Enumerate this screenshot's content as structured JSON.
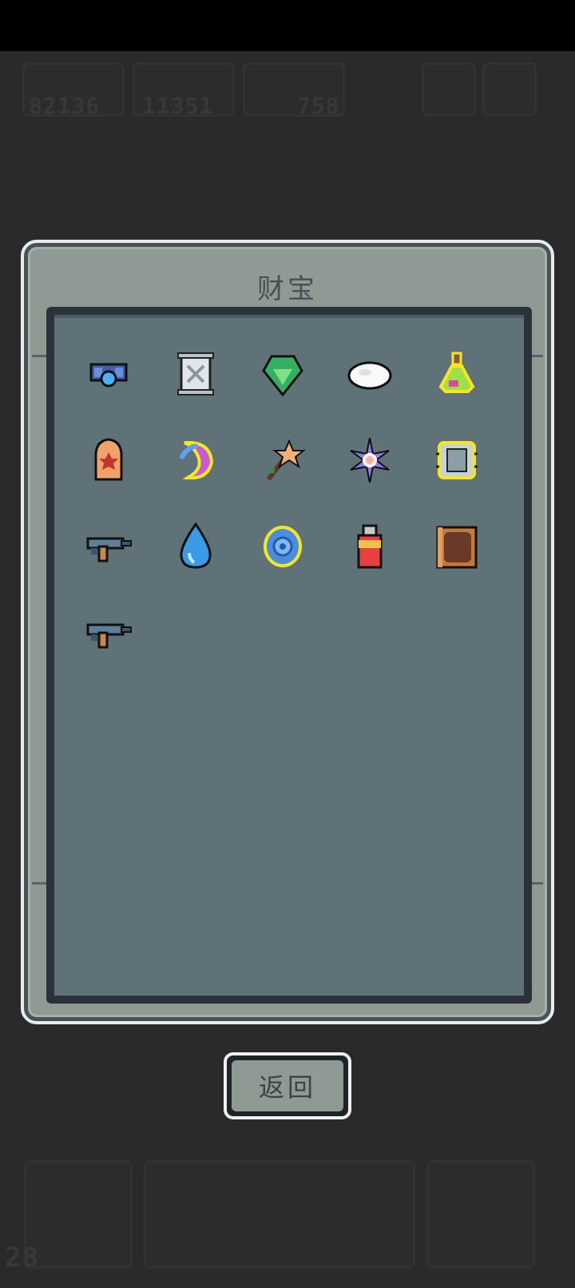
{
  "hud": {
    "gems": "82136",
    "coins": "11351",
    "materials": "758",
    "level": "28"
  },
  "dialog": {
    "title": "财宝",
    "back_label": "返回"
  },
  "treasures": [
    {
      "icon": "blue-orb-ribbon-icon",
      "highlighted": false
    },
    {
      "icon": "silver-scroll-icon",
      "highlighted": false
    },
    {
      "icon": "green-gem-icon",
      "highlighted": false
    },
    {
      "icon": "white-cloud-icon",
      "highlighted": false
    },
    {
      "icon": "potion-flask-icon",
      "highlighted": true
    },
    {
      "icon": "bullet-shell-icon",
      "highlighted": false
    },
    {
      "icon": "crescent-moon-icon",
      "highlighted": true
    },
    {
      "icon": "star-wand-icon",
      "highlighted": false
    },
    {
      "icon": "purple-flower-icon",
      "highlighted": false
    },
    {
      "icon": "stone-tablet-icon",
      "highlighted": true
    },
    {
      "icon": "blaster-gun-icon",
      "highlighted": false
    },
    {
      "icon": "water-drop-icon",
      "highlighted": false
    },
    {
      "icon": "blue-shield-icon",
      "highlighted": true
    },
    {
      "icon": "usb-drive-icon",
      "highlighted": false
    },
    {
      "icon": "leather-book-icon",
      "highlighted": false
    },
    {
      "icon": "blaster-gun-icon",
      "highlighted": false
    }
  ],
  "colors": {
    "highlight_outline": "#f5e61e",
    "panel": "#5e7278",
    "frame": "#8e9a93"
  }
}
